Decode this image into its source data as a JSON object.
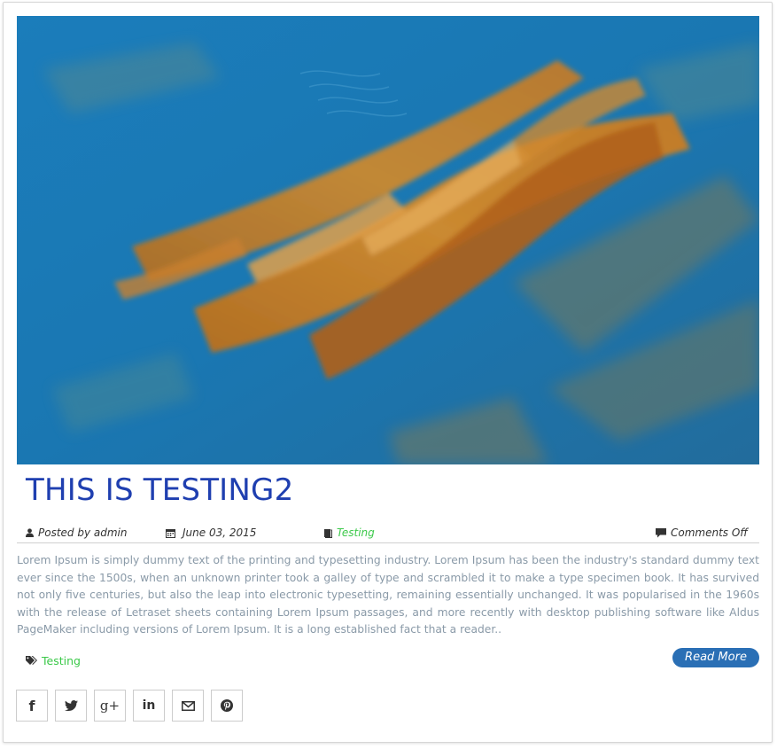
{
  "post": {
    "title": "THIS IS TESTING2",
    "meta": {
      "author_label": "Posted by admin",
      "date": "June 03, 2015",
      "category": "Testing",
      "comments": "Comments Off"
    },
    "excerpt": "Lorem Ipsum is simply dummy text of the printing and typesetting industry. Lorem Ipsum has been the industry's standard dummy text ever since the 1500s, when an unknown printer took a galley of type and scrambled it to make a type specimen book. It has survived not only five centuries, but also the leap into electronic typesetting, remaining essentially unchanged. It was popularised in the 1960s with the release of Letraset sheets containing Lorem Ipsum passages, and more recently with desktop publishing software like Aldus PageMaker including versions of Lorem Ipsum. It is a long established fact that a reader..",
    "tag": "Testing",
    "read_more_label": "Read More"
  },
  "share": [
    {
      "icon": "facebook-icon",
      "glyph": "f"
    },
    {
      "icon": "twitter-icon"
    },
    {
      "icon": "google-plus-icon",
      "glyph": "g+"
    },
    {
      "icon": "linkedin-icon",
      "glyph": "in"
    },
    {
      "icon": "email-icon"
    },
    {
      "icon": "pinterest-icon"
    }
  ],
  "colors": {
    "title": "#1f3fb0",
    "link": "#3cc94a",
    "button": "#2a6fb5",
    "excerpt": "#8a9aa8",
    "hero_blue": "#1a78b4",
    "hero_orange": "#c87a22"
  }
}
